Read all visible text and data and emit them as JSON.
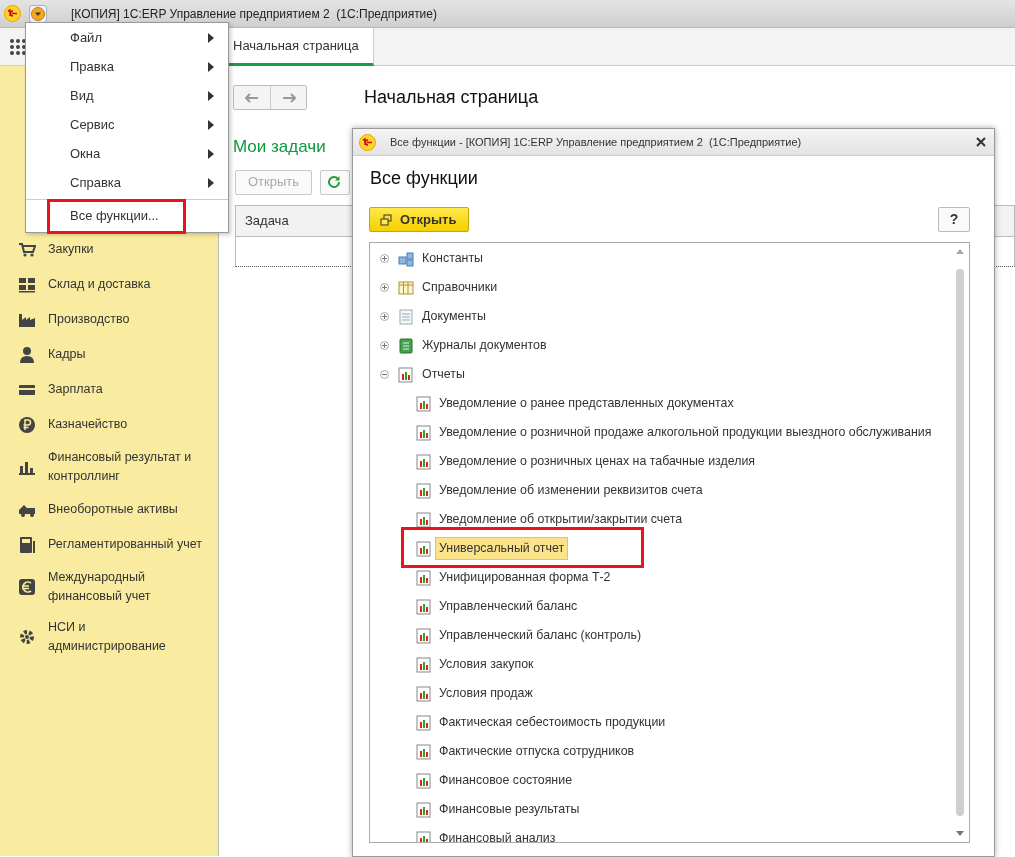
{
  "window": {
    "title": "[КОПИЯ] 1С:ERP Управление предприятием 2  (1С:Предприятие)"
  },
  "main_menu": {
    "items": [
      {
        "label": "Файл",
        "kind": "submenu",
        "highlighted": false
      },
      {
        "label": "Правка",
        "kind": "submenu",
        "highlighted": false
      },
      {
        "label": "Вид",
        "kind": "submenu",
        "highlighted": false
      },
      {
        "label": "Сервис",
        "kind": "submenu",
        "highlighted": false
      },
      {
        "label": "Окна",
        "kind": "submenu",
        "highlighted": false
      },
      {
        "label": "Справка",
        "kind": "submenu",
        "highlighted": false
      },
      {
        "label": "Все функции...",
        "kind": "command",
        "highlighted": true
      }
    ]
  },
  "tabs": [
    {
      "label": "Начальная страница",
      "selected": true
    }
  ],
  "sidebar": {
    "items": [
      {
        "label": "Закупки"
      },
      {
        "label": "Склад и доставка"
      },
      {
        "label": "Производство"
      },
      {
        "label": "Кадры"
      },
      {
        "label": "Зарплата"
      },
      {
        "label": "Казначейство"
      },
      {
        "label": "Финансовый результат и контроллинг"
      },
      {
        "label": "Внеоборотные активы"
      },
      {
        "label": "Регламентированный учет"
      },
      {
        "label": "Международный финансовый учет"
      },
      {
        "label": "НСИ и администрирование"
      }
    ]
  },
  "page": {
    "title": "Начальная страница",
    "section_title": "Мои задачи",
    "open_button": {
      "label": "Открыть",
      "disabled": true
    },
    "table": {
      "columns": [
        "Задача"
      ]
    }
  },
  "dialog": {
    "title": "Все функции - [КОПИЯ] 1С:ERP Управление предприятием 2  (1С:Предприятие)",
    "heading": "Все функции",
    "open_button": "Открыть",
    "help_button": "?",
    "tree": [
      {
        "label": "Константы",
        "expanded": false
      },
      {
        "label": "Справочники",
        "expanded": false
      },
      {
        "label": "Документы",
        "expanded": false
      },
      {
        "label": "Журналы документов",
        "expanded": false
      },
      {
        "label": "Отчеты",
        "expanded": true,
        "children": [
          {
            "label": "Уведомление о ранее представленных документах",
            "selected": false,
            "highlighted": false
          },
          {
            "label": "Уведомление о розничной продаже алкогольной продукции выездного обслуживания",
            "selected": false,
            "highlighted": false
          },
          {
            "label": "Уведомление о розничных ценах на табачные изделия",
            "selected": false,
            "highlighted": false
          },
          {
            "label": "Уведомление об изменении реквизитов счета",
            "selected": false,
            "highlighted": false
          },
          {
            "label": "Уведомление об открытии/закрытии счета",
            "selected": false,
            "highlighted": false
          },
          {
            "label": "Универсальный отчет",
            "selected": true,
            "highlighted": true
          },
          {
            "label": "Унифицированная форма Т-2",
            "selected": false,
            "highlighted": false
          },
          {
            "label": "Управленческий баланс",
            "selected": false,
            "highlighted": false
          },
          {
            "label": "Управленческий баланс (контроль)",
            "selected": false,
            "highlighted": false
          },
          {
            "label": "Условия закупок",
            "selected": false,
            "highlighted": false
          },
          {
            "label": "Условия продаж",
            "selected": false,
            "highlighted": false
          },
          {
            "label": "Фактическая себестоимость продукции",
            "selected": false,
            "highlighted": false
          },
          {
            "label": "Фактические отпуска сотрудников",
            "selected": false,
            "highlighted": false
          },
          {
            "label": "Финансовое состояние",
            "selected": false,
            "highlighted": false
          },
          {
            "label": "Финансовые результаты",
            "selected": false,
            "highlighted": false
          },
          {
            "label": "Финансовый анализ",
            "selected": false,
            "highlighted": false
          }
        ]
      }
    ]
  }
}
